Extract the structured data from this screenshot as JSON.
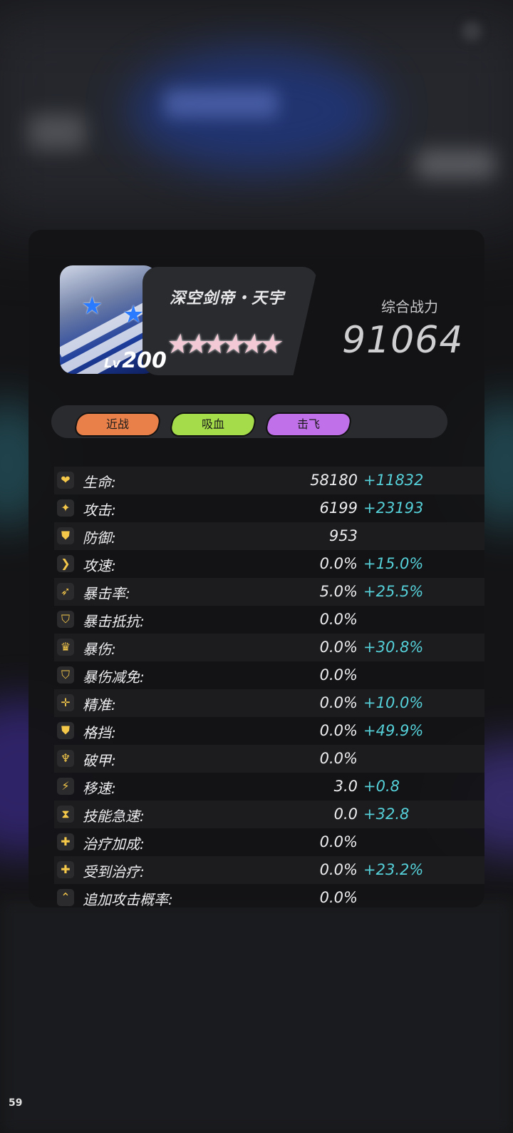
{
  "hero": {
    "name": "深空剑帝・天宇",
    "level_prefix": "Lv",
    "level": "200",
    "stars": 6,
    "star_glyph": "★",
    "power_label": "综合战力",
    "power_value": "91064"
  },
  "tags": [
    {
      "label": "近战",
      "color": "#e9804a"
    },
    {
      "label": "吸血",
      "color": "#a5dd4a"
    },
    {
      "label": "击飞",
      "color": "#c070e8"
    }
  ],
  "stats": [
    {
      "icon": "heart-icon",
      "glyph": "❤",
      "label": "生命:",
      "value": "58180",
      "bonus": "+11832"
    },
    {
      "icon": "sparkle-icon",
      "glyph": "✦",
      "label": "攻击:",
      "value": "6199",
      "bonus": "+23193"
    },
    {
      "icon": "shield-icon",
      "glyph": "⛊",
      "label": "防御:",
      "value": "953",
      "bonus": ""
    },
    {
      "icon": "chevron-right-icon",
      "glyph": "❯",
      "label": "攻速:",
      "value": "0.0%",
      "bonus": "+15.0%"
    },
    {
      "icon": "feather-icon",
      "glyph": "➶",
      "label": "暴击率:",
      "value": "5.0%",
      "bonus": "+25.5%"
    },
    {
      "icon": "crit-shield-icon",
      "glyph": "⛉",
      "label": "暴击抵抗:",
      "value": "0.0%",
      "bonus": ""
    },
    {
      "icon": "crown-icon",
      "glyph": "♛",
      "label": "暴伤:",
      "value": "0.0%",
      "bonus": "+30.8%"
    },
    {
      "icon": "crit-reduce-shield-icon",
      "glyph": "⛉",
      "label": "暴伤减免:",
      "value": "0.0%",
      "bonus": ""
    },
    {
      "icon": "crosshair-icon",
      "glyph": "✛",
      "label": "精准:",
      "value": "0.0%",
      "bonus": "+10.0%"
    },
    {
      "icon": "block-shield-icon",
      "glyph": "⛊",
      "label": "格挡:",
      "value": "0.0%",
      "bonus": "+49.9%"
    },
    {
      "icon": "armor-break-icon",
      "glyph": "♆",
      "label": "破甲:",
      "value": "0.0%",
      "bonus": ""
    },
    {
      "icon": "lightning-icon",
      "glyph": "⚡",
      "label": "移速:",
      "value": "3.0",
      "bonus": "+0.8"
    },
    {
      "icon": "hourglass-icon",
      "glyph": "⧗",
      "label": "技能急速:",
      "value": "0.0",
      "bonus": "+32.8"
    },
    {
      "icon": "healing-cross-icon",
      "glyph": "✚",
      "label": "治疗加成:",
      "value": "0.0%",
      "bonus": ""
    },
    {
      "icon": "received-healing-icon",
      "glyph": "✚",
      "label": "受到治疗:",
      "value": "0.0%",
      "bonus": "+23.2%"
    },
    {
      "icon": "extra-attack-icon",
      "glyph": "⌃",
      "label": "追加攻击概率:",
      "value": "0.0%",
      "bonus": ""
    }
  ],
  "fps": "59"
}
